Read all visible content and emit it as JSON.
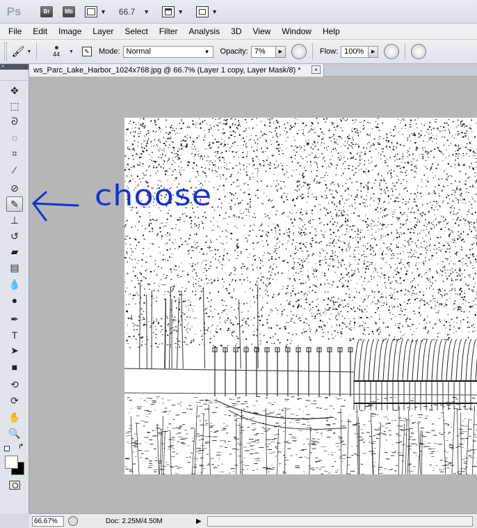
{
  "app": {
    "logo": "Ps",
    "bridge_label": "Br",
    "minibridge_label": "Mb",
    "zoom_value": "66.7"
  },
  "menu": [
    "File",
    "Edit",
    "Image",
    "Layer",
    "Select",
    "Filter",
    "Analysis",
    "3D",
    "View",
    "Window",
    "Help"
  ],
  "options": {
    "brush_size": "44",
    "mode_label": "Mode:",
    "mode_value": "Normal",
    "opacity_label": "Opacity:",
    "opacity_value": "7%",
    "flow_label": "Flow:",
    "flow_value": "100%"
  },
  "toolbox": {
    "expand_label": "»",
    "active_tool": "brush-tool",
    "tools": [
      {
        "name": "move-tool",
        "glyph": "✥"
      },
      {
        "name": "marquee-tool",
        "glyph": "⬚"
      },
      {
        "name": "lasso-tool",
        "glyph": "ᘐ"
      },
      {
        "name": "quick-selection-tool",
        "glyph": "◌"
      },
      {
        "name": "crop-tool",
        "glyph": "⌗"
      },
      {
        "name": "eyedropper-tool",
        "glyph": "⁄"
      },
      {
        "name": "healing-brush-tool",
        "glyph": "⊘"
      },
      {
        "name": "brush-tool",
        "glyph": "✎"
      },
      {
        "name": "clone-stamp-tool",
        "glyph": "⊥"
      },
      {
        "name": "history-brush-tool",
        "glyph": "↺"
      },
      {
        "name": "eraser-tool",
        "glyph": "▰"
      },
      {
        "name": "gradient-tool",
        "glyph": "▤"
      },
      {
        "name": "blur-tool",
        "glyph": "💧"
      },
      {
        "name": "dodge-tool",
        "glyph": "●"
      },
      {
        "name": "pen-tool",
        "glyph": "✒"
      },
      {
        "name": "type-tool",
        "glyph": "T"
      },
      {
        "name": "path-selection-tool",
        "glyph": "➤"
      },
      {
        "name": "shape-tool",
        "glyph": "■"
      },
      {
        "name": "3d-rotate-tool",
        "glyph": "⟲"
      },
      {
        "name": "3d-orbit-tool",
        "glyph": "⟳"
      },
      {
        "name": "hand-tool",
        "glyph": "✋"
      },
      {
        "name": "zoom-tool",
        "glyph": "🔍"
      }
    ]
  },
  "document": {
    "tab_title": "ws_Parc_Lake_Harbor_1024x768.jpg @ 66.7% (Layer 1 copy, Layer Mask/8) *",
    "close_label": "×"
  },
  "status": {
    "zoom": "66.67%",
    "doc_info": "Doc: 2.25M/4.50M"
  },
  "annotation": {
    "text": "choose",
    "color": "#1230d8"
  }
}
